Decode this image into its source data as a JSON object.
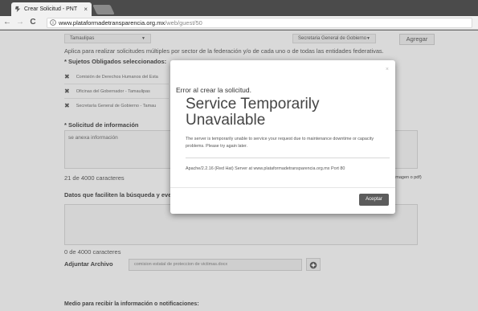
{
  "browser": {
    "tab_title": "Crear Solicitud - PNT",
    "tab_close": "×",
    "back": "←",
    "forward": "→",
    "reload": "C",
    "url_host": "www.plataformadetransparencia.org.mx",
    "url_path": "/web/guest/50"
  },
  "form": {
    "state_select": "Tamaulipas",
    "agency_select": "Secretaria General de Gobierno",
    "add_button": "Agregar",
    "multi_hint": "Aplica para realizar solicitudes múltiples por sector de la federación y/o de cada uno o de todas las entidades federativas.",
    "obligados_label": "* Sujetos Obligados seleccionados:",
    "obligados": [
      "Comisión de Derechos Humanos del Esta",
      "Oficinas del Gobernador - Tamaulipas",
      "Secretaría General de Gobierno - Tamau"
    ],
    "solicitud_label": "* Solicitud de información",
    "solicitud_value": "se anexa información",
    "counter_1": "21 de 4000 caracteres",
    "file_hint_fragment": ", imagen o pdf)",
    "datos_label": "Datos que faciliten la búsqueda y even",
    "counter_2": "0 de 4000 caracteres",
    "adjuntar_label": "Adjuntar Archivo",
    "file_name": "comision estatal de proteccion de victimas.docx",
    "medio_label": "Medio para recibir la información o notificaciones:"
  },
  "modal": {
    "close": "×",
    "heading": "Error al crear la solicitud.",
    "title": "Service Temporarily Unavailable",
    "message": "The server is temporarily unable to service your request due to maintenance downtime or capacity problems. Please try again later.",
    "server_line": "Apache/2.2.16 (Red Hat) Server at www.plataformadetransparencia.org.mx Port 80",
    "accept_button": "Aceptar"
  },
  "colors": {
    "overlay_page": "#d9d9d9",
    "modal_bg": "#ffffff",
    "accept_bg": "#5c5c5c"
  }
}
